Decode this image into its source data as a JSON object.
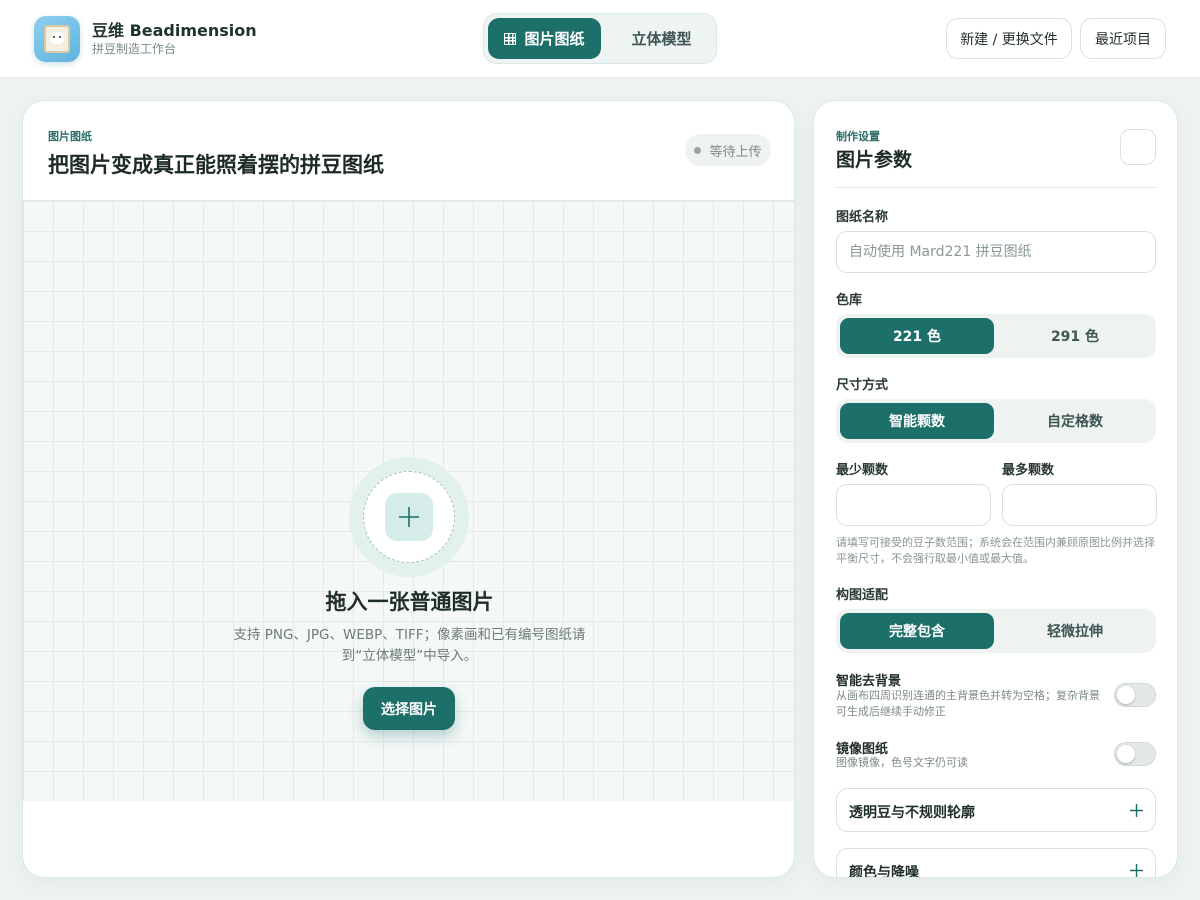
{
  "header": {
    "brand_title": "豆维 Beadimension",
    "brand_subtitle": "拼豆制造工作台",
    "modes": [
      {
        "label": "图片图纸",
        "active": true
      },
      {
        "label": "立体模型",
        "active": false
      }
    ],
    "new_file_label": "新建 / 更换文件",
    "recent_label": "最近项目"
  },
  "workspace": {
    "eyebrow": "图片图纸",
    "title": "把图片变成真正能照着摆的拼豆图纸",
    "status": "等待上传",
    "drop_title": "拖入一张普通图片",
    "drop_desc_line1": "支持 PNG、JPG、WEBP、TIFF；像素画和已有编号图纸请",
    "drop_desc_line2": "到“立体模型”中导入。",
    "choose_button": "选择图片"
  },
  "settings": {
    "eyebrow": "制作设置",
    "title": "图片参数",
    "name_label": "图纸名称",
    "name_placeholder": "自动使用 Mard221 拼豆图纸",
    "name_value": "",
    "palette_label": "色库",
    "palette_options": [
      "221 色",
      "291 色"
    ],
    "palette_selected": "221 色",
    "size_label": "尺寸方式",
    "size_options": [
      "智能颗数",
      "自定格数"
    ],
    "size_selected": "智能颗数",
    "min_label": "最少颗数",
    "max_label": "最多颗数",
    "min_value": "",
    "max_value": "",
    "size_hint": "请填写可接受的豆子数范围；系统会在范围内兼顾原图比例并选择平衡尺寸，不会强行取最小值或最大值。",
    "fit_label": "构图适配",
    "fit_options": [
      "完整包含",
      "轻微拉伸"
    ],
    "fit_selected": "完整包含",
    "remove_bg_title": "智能去背景",
    "remove_bg_desc": "从画布四周识别连通的主背景色并转为空格；复杂背景可生成后继续手动修正",
    "remove_bg_on": false,
    "mirror_title": "镜像图纸",
    "mirror_desc": "图像镜像，色号文字仍可读",
    "mirror_on": false,
    "accordions": [
      "透明豆与不规则轮廓",
      "颜色与降噪"
    ]
  },
  "colors": {
    "accent": "#1d6f69",
    "background": "#eef3f2"
  }
}
